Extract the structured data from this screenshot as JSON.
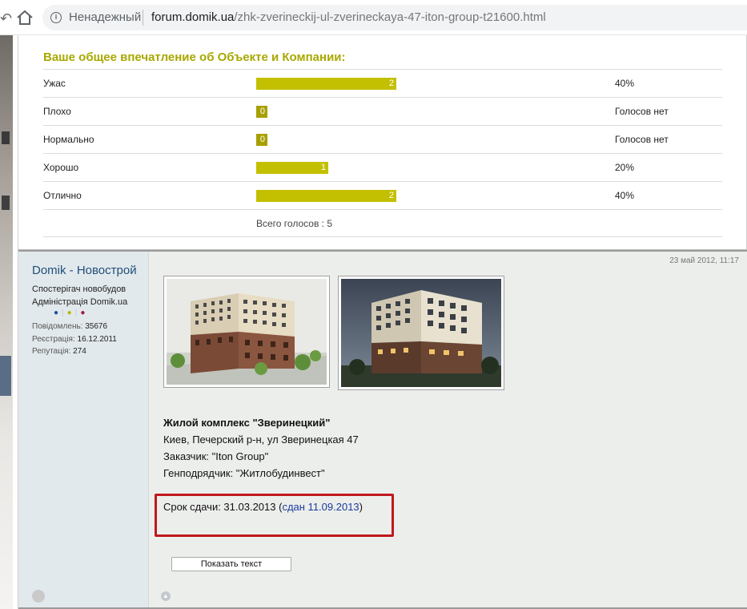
{
  "browser": {
    "security_label": "Ненадежный",
    "url_host": "forum.domik.ua",
    "url_path": "/zhk-zverineckij-ul-zverineckaya-47-iton-group-t21600.html"
  },
  "poll": {
    "title": "Ваше общее впечатление об Объекте и Компании:",
    "accent_color": "#c2c000",
    "rows": [
      {
        "label": "Ужас",
        "votes": "2",
        "share": 0.4,
        "percent": "40%"
      },
      {
        "label": "Плохо",
        "votes": "0",
        "share": 0,
        "percent": "Голосов нет"
      },
      {
        "label": "Нормально",
        "votes": "0",
        "share": 0,
        "percent": "Голосов нет"
      },
      {
        "label": "Хорошо",
        "votes": "1",
        "share": 0.2,
        "percent": "20%"
      },
      {
        "label": "Отлично",
        "votes": "2",
        "share": 0.4,
        "percent": "40%"
      }
    ],
    "total": "Всего голосов : 5"
  },
  "post": {
    "author": "Domik - Новострой",
    "rank_line1": "Спостерігач новобудов",
    "rank_line2": "Адміністрація Domik.ua",
    "stats": [
      {
        "label": "Повідомлень:",
        "value": "35676"
      },
      {
        "label": "Реєстрація:",
        "value": "16.12.2011"
      },
      {
        "label": "Репутація:",
        "value": "274"
      }
    ],
    "date": "23 май 2012, 11:17",
    "lines": [
      "Жилой комплекс \"Зверинецкий\"",
      "Киев, Печерский р-н, ул Зверинецкая 47",
      "Заказчик: \"Iton Group\"",
      "Генподрядчик: \"Житлобудинвест\""
    ],
    "deadline_prefix": "Срок сдачи: 31.03.2013 (",
    "deadline_link": "сдан 11.09.2013",
    "deadline_suffix": ")",
    "show_text_button": "Показать текст"
  }
}
